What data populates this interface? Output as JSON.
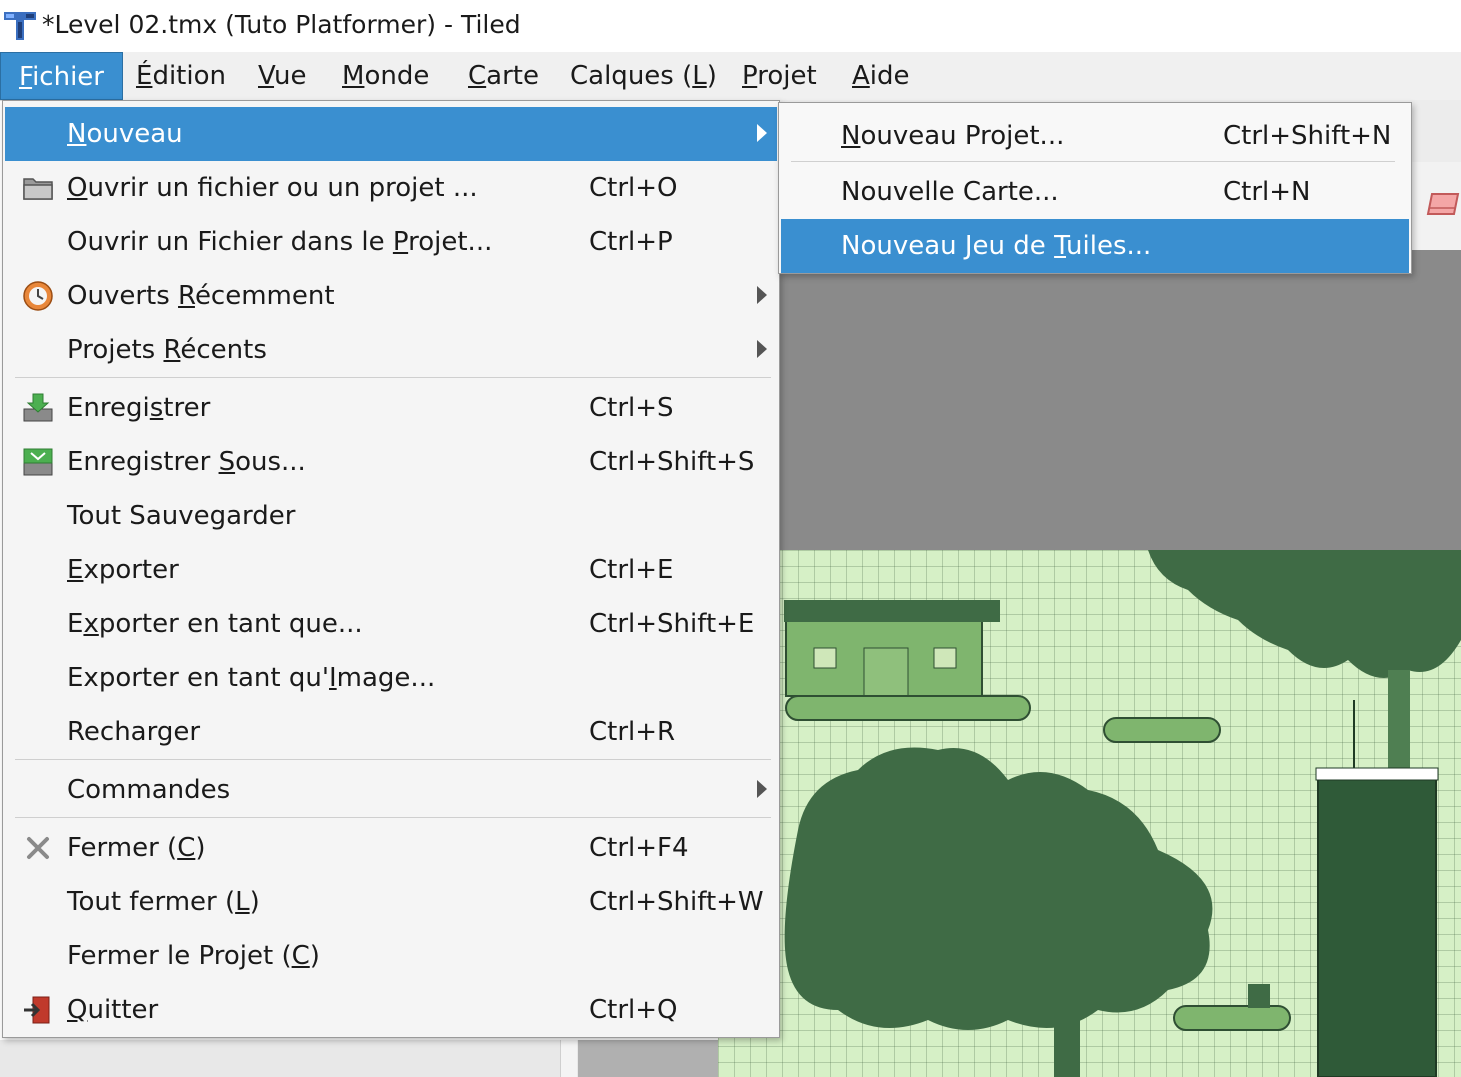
{
  "window": {
    "title": "*Level 02.tmx (Tuto Platformer) - Tiled",
    "app_icon": "tiled-logo-icon"
  },
  "menubar": {
    "items": [
      {
        "pre": "",
        "u": "F",
        "post": "ichier"
      },
      {
        "pre": "",
        "u": "É",
        "post": "dition"
      },
      {
        "pre": "",
        "u": "V",
        "post": "ue"
      },
      {
        "pre": "",
        "u": "M",
        "post": "onde"
      },
      {
        "pre": "",
        "u": "C",
        "post": "arte"
      },
      {
        "pre": "Calques (",
        "u": "L",
        "post": ")"
      },
      {
        "pre": "",
        "u": "P",
        "post": "rojet"
      },
      {
        "pre": "",
        "u": "A",
        "post": "ide"
      }
    ]
  },
  "file_menu": {
    "items": [
      {
        "pre": "",
        "u": "N",
        "post": "ouveau",
        "shortcut": "",
        "icon": "",
        "submenu": true
      },
      {
        "pre": "",
        "u": "O",
        "post": "uvrir un fichier ou un projet ...",
        "shortcut": "Ctrl+O",
        "icon": "folder-open-icon"
      },
      {
        "pre": "Ouvrir un Fichier dans le ",
        "u": "P",
        "post": "rojet...",
        "shortcut": "Ctrl+P",
        "icon": ""
      },
      {
        "pre": "Ouverts ",
        "u": "R",
        "post": "écemment",
        "shortcut": "",
        "icon": "recent-files-icon",
        "submenu": true
      },
      {
        "pre": "Projets ",
        "u": "R",
        "post": "écents",
        "shortcut": "",
        "icon": "",
        "submenu": true
      },
      {
        "pre": "Enregi",
        "u": "s",
        "post": "trer",
        "shortcut": "Ctrl+S",
        "icon": "save-icon"
      },
      {
        "pre": "Enregistrer ",
        "u": "S",
        "post": "ous...",
        "shortcut": "Ctrl+Shift+S",
        "icon": "save-as-icon"
      },
      {
        "pre": "Tout Sauvegarder",
        "u": "",
        "post": "",
        "shortcut": "",
        "icon": ""
      },
      {
        "pre": "",
        "u": "E",
        "post": "xporter",
        "shortcut": "Ctrl+E",
        "icon": ""
      },
      {
        "pre": "E",
        "u": "x",
        "post": "porter en tant que...",
        "shortcut": "Ctrl+Shift+E",
        "icon": ""
      },
      {
        "pre": "Exporter en tant qu'",
        "u": "I",
        "post": "mage...",
        "shortcut": "",
        "icon": ""
      },
      {
        "pre": "Recharger",
        "u": "",
        "post": "",
        "shortcut": "Ctrl+R",
        "icon": ""
      },
      {
        "pre": "Commandes",
        "u": "",
        "post": "",
        "shortcut": "",
        "icon": "",
        "submenu": true
      },
      {
        "pre": "Fermer (",
        "u": "C",
        "post": ")",
        "shortcut": "Ctrl+F4",
        "icon": "close-icon"
      },
      {
        "pre": "Tout fermer (",
        "u": "L",
        "post": ")",
        "shortcut": "Ctrl+Shift+W",
        "icon": ""
      },
      {
        "pre": "Fermer le Projet (",
        "u": "C",
        "post": ")",
        "shortcut": "",
        "icon": ""
      },
      {
        "pre": "",
        "u": "Q",
        "post": "uitter",
        "shortcut": "Ctrl+Q",
        "icon": "quit-icon"
      }
    ]
  },
  "new_submenu": {
    "items": [
      {
        "pre": "",
        "u": "N",
        "post": "ouveau Projet...",
        "shortcut": "Ctrl+Shift+N"
      },
      {
        "pre": "Nouvelle Carte...",
        "u": "",
        "post": "",
        "shortcut": "Ctrl+N"
      },
      {
        "pre": "Nouveau Jeu de ",
        "u": "T",
        "post": "uiles...",
        "shortcut": ""
      }
    ]
  },
  "colors": {
    "highlight": "#3a8fd0",
    "menu_bg": "#f5f5f5",
    "map_bg": "#d6f0c6",
    "tree_dark": "#3f6b45"
  }
}
